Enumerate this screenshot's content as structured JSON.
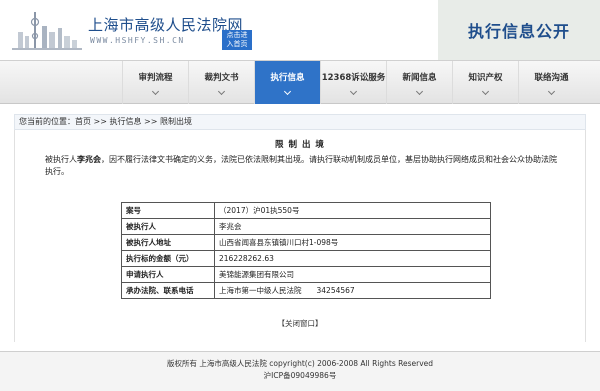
{
  "header": {
    "site_title": "上海市高级人民法院网",
    "site_url": "WWW.HSHFY.SH.CN",
    "enter_button_line1": "点击进",
    "enter_button_line2": "入首页",
    "banner_title": "执行信息公开"
  },
  "nav": {
    "items": [
      {
        "label": "审判流程"
      },
      {
        "label": "裁判文书"
      },
      {
        "label": "执行信息"
      },
      {
        "label": "12368诉讼服务"
      },
      {
        "label": "新闻信息"
      },
      {
        "label": "知识产权"
      },
      {
        "label": "联络沟通"
      }
    ],
    "active_index": 2
  },
  "breadcrumb": {
    "prefix": "您当前的位置：",
    "home": "首页",
    "sep": ">>",
    "section": "执行信息",
    "page": "限制出境"
  },
  "notice": {
    "title": "限 制 出 境",
    "lead": "被执行人",
    "name": "李兆会",
    "body": "，因不履行法律文书确定的义务，法院已依法限制其出境。请执行联动机制成员单位，基层协助执行网络成员和社会公众协助法院执行。"
  },
  "table": {
    "rows": [
      {
        "key": "案号",
        "value": "（2017）沪01执550号"
      },
      {
        "key": "被执行人",
        "value": "李兆会"
      },
      {
        "key": "被执行人地址",
        "value": "山西省闻喜县东镇镇川口村1-098号"
      },
      {
        "key": "执行标的金额（元）",
        "value": "216228262.63"
      },
      {
        "key": "申请执行人",
        "value": "美锦能源集团有限公司"
      },
      {
        "key": "承办法院、联系电话",
        "value": "上海市第一中级人民法院　　34254567"
      }
    ]
  },
  "close_link": "【关闭窗口】",
  "footer": {
    "line1": "版权所有 上海市高级人民法院 copyright(c) 2006-2008 All Rights Reserved",
    "line2": "沪ICP备09049986号"
  },
  "colors": {
    "brand_blue": "#1f4e8c",
    "active_nav": "#2f73c8",
    "banner_bg": "#e8ece8"
  }
}
